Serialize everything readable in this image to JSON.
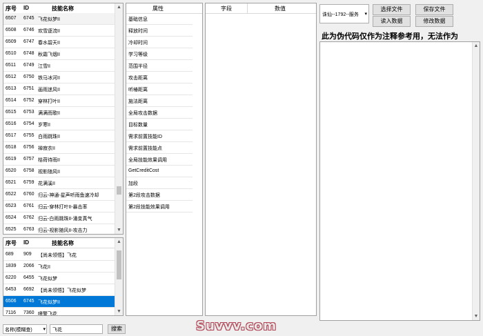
{
  "skill_list": {
    "headers": [
      "序号",
      "ID",
      "技能名称"
    ],
    "rows": [
      [
        "6507",
        "6745",
        "飞花似梦II"
      ],
      [
        "6508",
        "6746",
        "欢雪逐流II"
      ],
      [
        "6509",
        "6747",
        "春水碧天II"
      ],
      [
        "6510",
        "6748",
        "秋霜飞烟II"
      ],
      [
        "6511",
        "6749",
        "江雪II"
      ],
      [
        "6512",
        "6750",
        "铁马冰河II"
      ],
      [
        "6513",
        "6751",
        "画雨迷风II"
      ],
      [
        "6514",
        "6752",
        "穿林打叶II"
      ],
      [
        "6515",
        "6753",
        "满满而歌II"
      ],
      [
        "6516",
        "6754",
        "岁寒II"
      ],
      [
        "6517",
        "6755",
        "白雨跳珠II"
      ],
      [
        "6518",
        "6756",
        "禅寂衣II"
      ],
      [
        "6519",
        "6757",
        "桔荷待雨II"
      ],
      [
        "6520",
        "6758",
        "视影随风II"
      ],
      [
        "6521",
        "6759",
        "花满溪II"
      ],
      [
        "6522",
        "6760",
        "归云-神通-星声听雨鱼速冷却"
      ],
      [
        "6523",
        "6761",
        "归云-穿林打叶II-暴击率"
      ],
      [
        "6524",
        "6762",
        "归云-白雨跳珠II-涌变真气"
      ],
      [
        "6525",
        "6763",
        "归云-视影随风II-攻击力"
      ]
    ]
  },
  "search_results": {
    "headers": [
      "序号",
      "ID",
      "技能名称"
    ],
    "rows": [
      [
        "689",
        "909",
        "【尚未领悟】飞花"
      ],
      [
        "1839",
        "2066",
        "飞花II"
      ],
      [
        "6220",
        "6455",
        "飞花似梦"
      ],
      [
        "6453",
        "6692",
        "【尚未领悟】飞花似梦"
      ],
      [
        "6506",
        "6745",
        "飞花似梦II"
      ],
      [
        "7116",
        "7360",
        "嗜警飞花"
      ]
    ],
    "selected_index": 4
  },
  "attributes": {
    "header": "属性",
    "items": [
      "基础信息",
      "释放时间",
      "冷却时间",
      "学习等级",
      "范围半径",
      "攻击距离",
      "听椿距离",
      "施法距离",
      "全局攻击数据",
      "目标数量",
      "需求前置技能ID",
      "需求前置技能点",
      "全局技能效果调用",
      "GetCreditCost",
      "加段",
      "第2段攻击数据",
      "第2段技能效果调用"
    ]
  },
  "fields_table": {
    "col1": "字段",
    "col2": "数值"
  },
  "top_controls": {
    "combo_value": "诛仙--1792--服务",
    "select_file": "选择文件",
    "save_file": "保存文件",
    "read_data": "读入数据",
    "modify_data": "修改数据"
  },
  "note_text": "此为伪代码仅作为注释参考用，无法作为",
  "search_bar": {
    "mode": "名称(模糊查)",
    "query": "飞花",
    "search_button": "搜索"
  },
  "watermark": "Suvvv.com"
}
